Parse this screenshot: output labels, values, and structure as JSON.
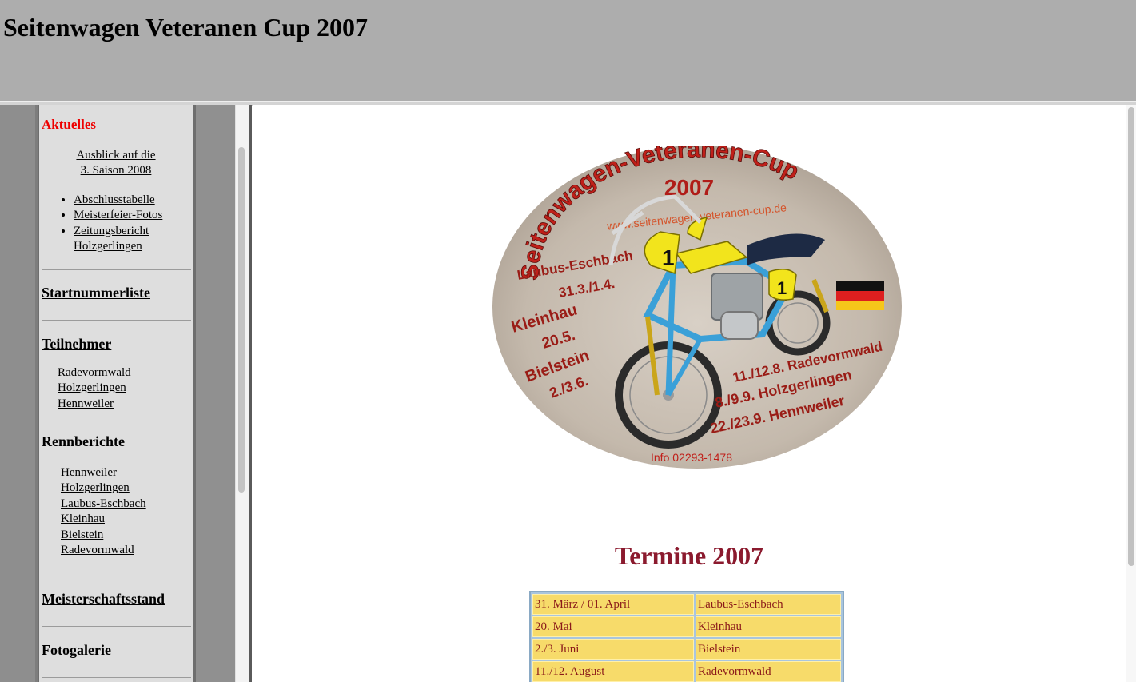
{
  "header": {
    "title": "Seitenwagen Veteranen Cup 2007"
  },
  "nav": {
    "aktuelles": {
      "label": "Aktuelles",
      "sub_link_line1": "Ausblick auf die",
      "sub_link_line2": "3. Saison 2008",
      "bullets": [
        "Abschlusstabelle",
        "Meisterfeier-Fotos",
        "Zeitungsbericht",
        "Holzgerlingen"
      ]
    },
    "startnummerliste": {
      "label": "Startnummerliste"
    },
    "teilnehmer": {
      "label": "Teilnehmer",
      "links": [
        "Radevormwald",
        "Holzgerlingen",
        "Hennweiler"
      ]
    },
    "rennberichte": {
      "label": "Rennberichte",
      "links": [
        "Hennweiler",
        "Holzgerlingen",
        "Laubus-Eschbach",
        "Kleinhau",
        "Bielstein",
        "Radevormwald"
      ]
    },
    "meisterschaftsstand": {
      "label": "Meisterschaftsstand"
    },
    "fotogalerie": {
      "label": "Fotogalerie"
    }
  },
  "logo": {
    "arc_text": "Seitenwagen-Veteranen-Cup",
    "year": "2007",
    "url": "www.seitenwagen-veteranen-cup.de",
    "left_events": [
      "Laubus-Eschbach",
      "31.3./1.4.",
      "Kleinhau",
      "20.5.",
      "Bielstein",
      "2./3.6."
    ],
    "right_events": [
      "11./12.8.  Radevormwald",
      "8./9.9. Holzgerlingen",
      "22./23.9.  Hennweiler"
    ],
    "info": "Info 02293-1478",
    "number": "1",
    "colors": {
      "text_red": "#c0201a",
      "frame_blue": "#3aa0d8",
      "plate_yellow": "#f2e41c",
      "gravel": "#c9bfb2"
    }
  },
  "main": {
    "termine_title": "Termine 2007",
    "dates": [
      {
        "date": "31. März / 01. April",
        "place": "Laubus-Eschbach"
      },
      {
        "date": "20. Mai",
        "place": "Kleinhau"
      },
      {
        "date": "2./3. Juni",
        "place": "Bielstein"
      },
      {
        "date": "11./12. August",
        "place": "Radevormwald"
      }
    ]
  }
}
